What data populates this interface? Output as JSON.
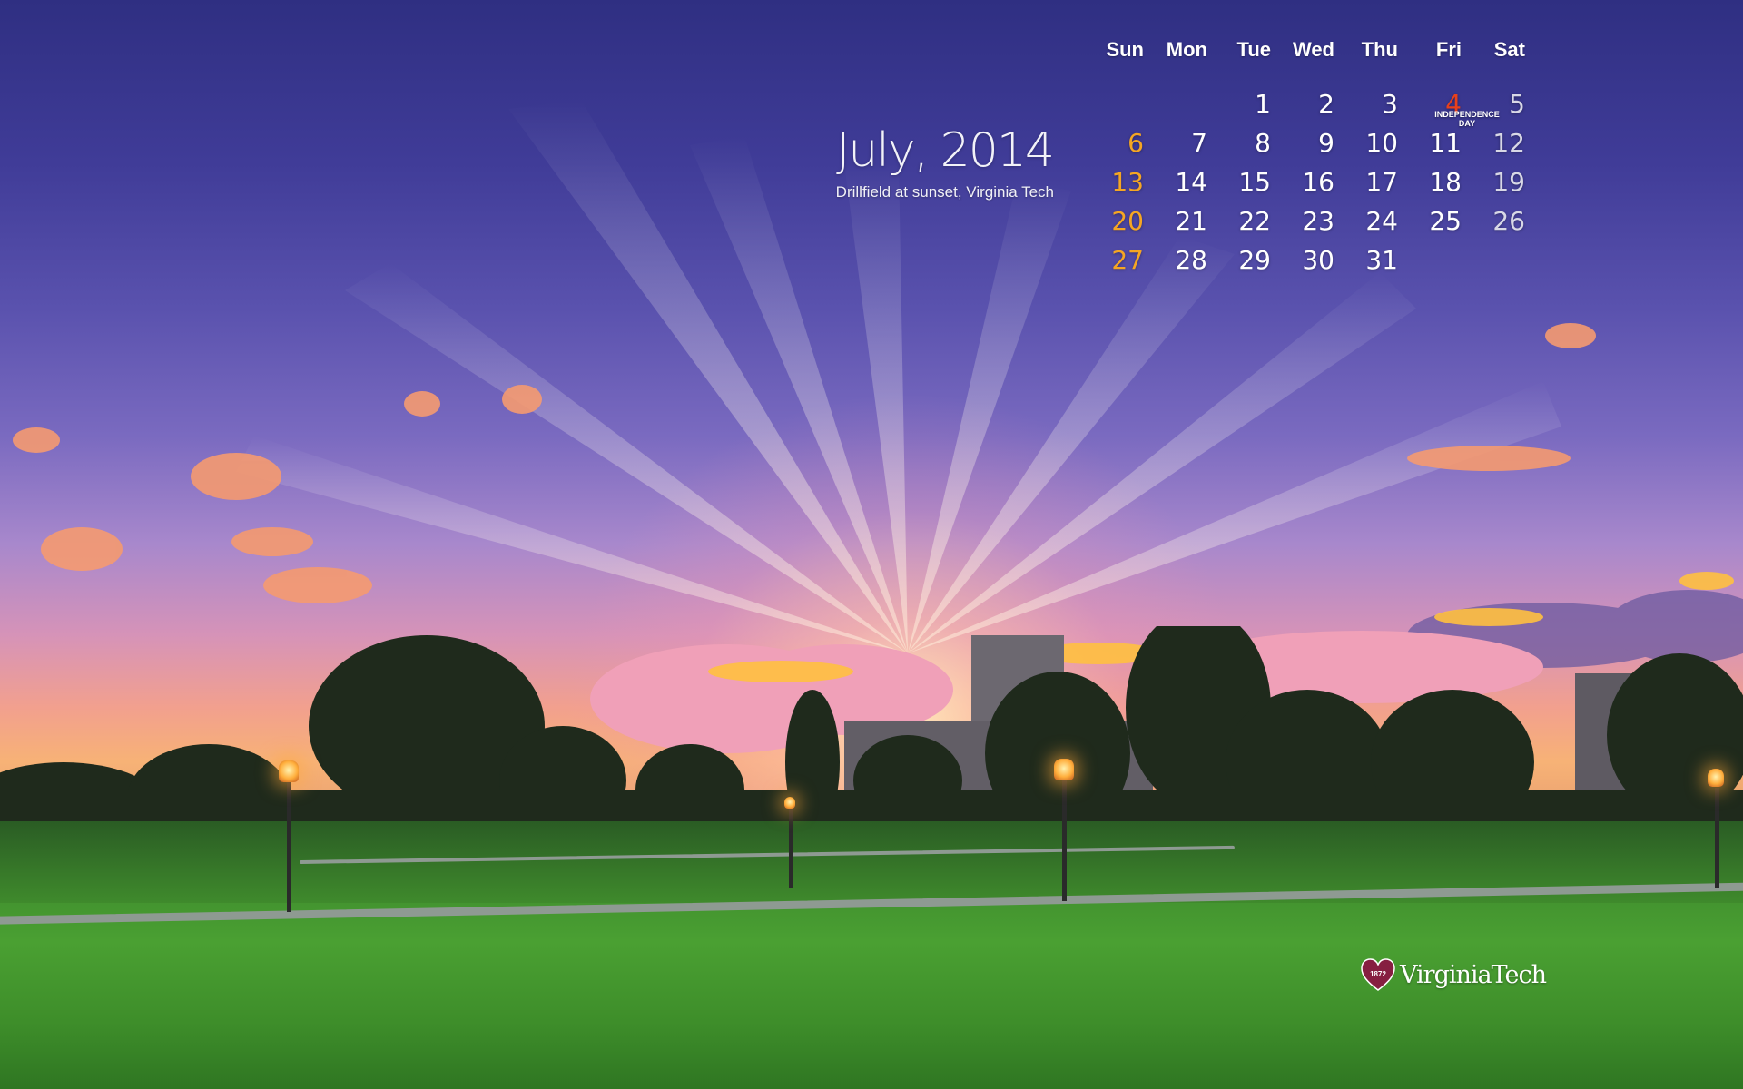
{
  "header": {
    "month_title": "July, 2014",
    "caption": "Drillfield at sunset, Virginia Tech"
  },
  "calendar": {
    "day_names": [
      "Sun",
      "Mon",
      "Tue",
      "Wed",
      "Thu",
      "Fri",
      "Sat"
    ],
    "weeks": [
      [
        "",
        "",
        "1",
        "2",
        "3",
        "4",
        "5"
      ],
      [
        "6",
        "7",
        "8",
        "9",
        "10",
        "11",
        "12"
      ],
      [
        "13",
        "14",
        "15",
        "16",
        "17",
        "18",
        "19"
      ],
      [
        "20",
        "21",
        "22",
        "23",
        "24",
        "25",
        "26"
      ],
      [
        "27",
        "28",
        "29",
        "30",
        "31",
        "",
        ""
      ]
    ],
    "holiday": {
      "date": "4",
      "label": "INDEPENDENCE DAY"
    }
  },
  "logo": {
    "year": "1872",
    "text": "VirginiaTech"
  },
  "colors": {
    "sunday": "#f5a623",
    "saturday": "#d8d8e6",
    "holiday": "#e8401c",
    "logo_heart": "#861f41"
  },
  "icons": {
    "logo_mark": "heart-icon"
  }
}
